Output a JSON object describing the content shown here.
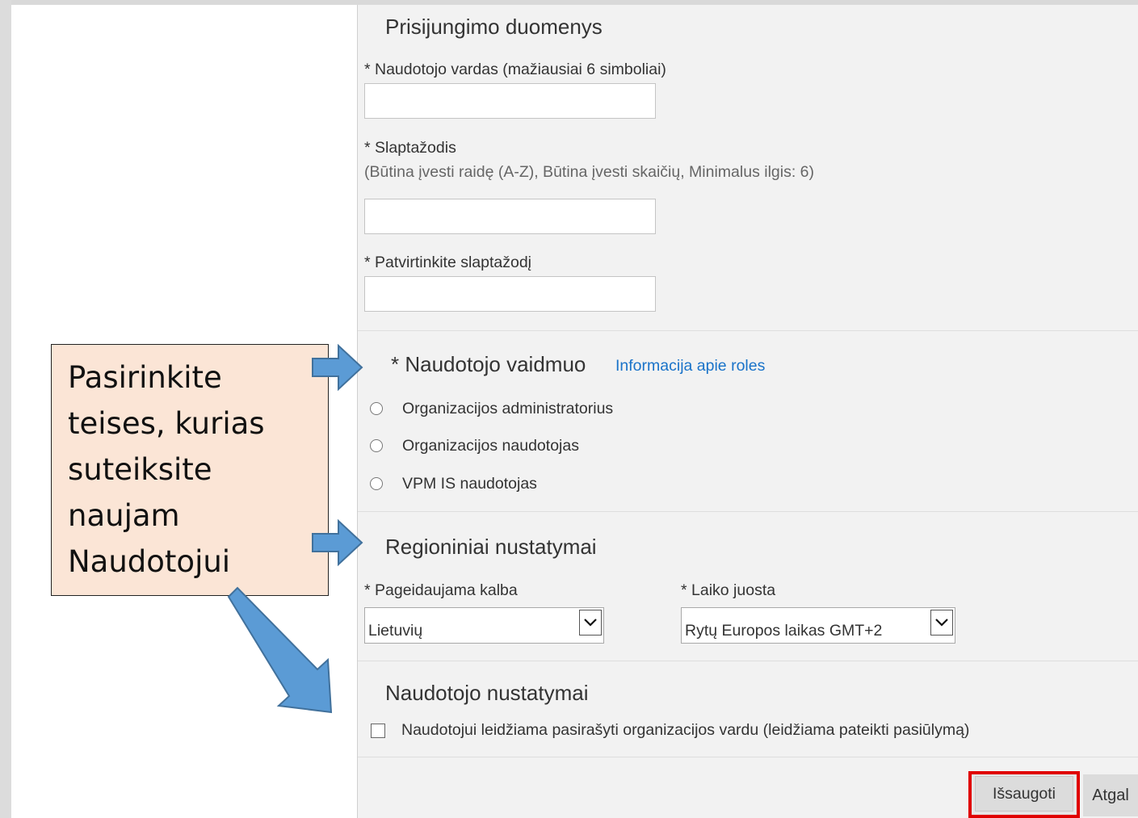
{
  "login_section": {
    "heading": "Prisijungimo duomenys",
    "username_label": "* Naudotojo vardas (mažiausiai 6 simboliai)",
    "username_value": "",
    "password_label": "* Slaptažodis",
    "password_hint": "(Būtina įvesti raidę (A-Z), Būtina įvesti skaičių, Minimalus ilgis: 6)",
    "password_value": "",
    "confirm_label": "* Patvirtinkite slaptažodį",
    "confirm_value": ""
  },
  "role_section": {
    "heading": "* Naudotojo vaidmuo",
    "info_link": "Informacija apie roles",
    "options": [
      "Organizacijos administratorius",
      "Organizacijos naudotojas",
      "VPM IS naudotojas"
    ]
  },
  "regional_section": {
    "heading": "Regioniniai nustatymai",
    "language_label": "* Pageidaujama kalba",
    "language_value": "Lietuvių",
    "timezone_label": "* Laiko juosta",
    "timezone_value": "Rytų Europos laikas GMT+2"
  },
  "user_settings_section": {
    "heading": "Naudotojo nustatymai",
    "sign_checkbox_label": "Naudotojui leidžiama pasirašyti organizacijos vardu (leidžiama pateikti pasiūlymą)",
    "sign_checkbox_checked": false
  },
  "buttons": {
    "save": "Išsaugoti",
    "back": "Atgal"
  },
  "callout": {
    "lines": [
      "Pasirinkite",
      "teises, kurias",
      "suteiksite",
      "naujam",
      "Naudotojui"
    ]
  },
  "colors": {
    "panel_bg": "#f2f2f2",
    "link": "#1a73c9",
    "highlight_border": "#e00000",
    "callout_bg": "#fbe5d6",
    "arrow_fill": "#5b9bd5",
    "arrow_stroke": "#41719c"
  }
}
